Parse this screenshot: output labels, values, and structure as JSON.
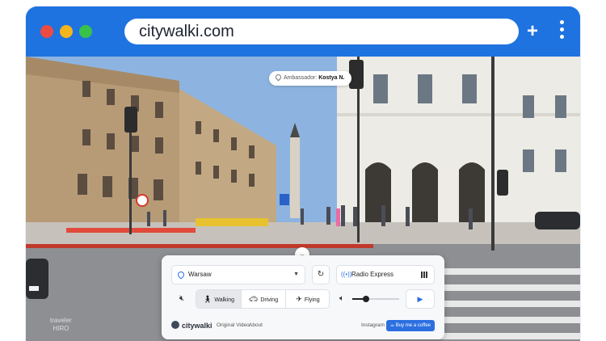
{
  "browser": {
    "url": "citywalki.com",
    "new_tab_icon": "plus-icon",
    "menu_icon": "kebab-menu-icon"
  },
  "overlay": {
    "ambassador_label": "Ambassador:",
    "ambassador_name": "Kostya N."
  },
  "controls": {
    "city": "Warsaw",
    "radio": "Radio Express",
    "modes": [
      "Walking",
      "Driving",
      "Flying"
    ],
    "selected_mode": "Walking",
    "volume_level": 0.3
  },
  "footer": {
    "brand": "citywalki",
    "original_video": "Original Video",
    "about": "About",
    "instagram": "Instagram",
    "coffee": "Buy me a coffee"
  },
  "watermark": {
    "line1": "traveler",
    "line2": "HIRO"
  }
}
